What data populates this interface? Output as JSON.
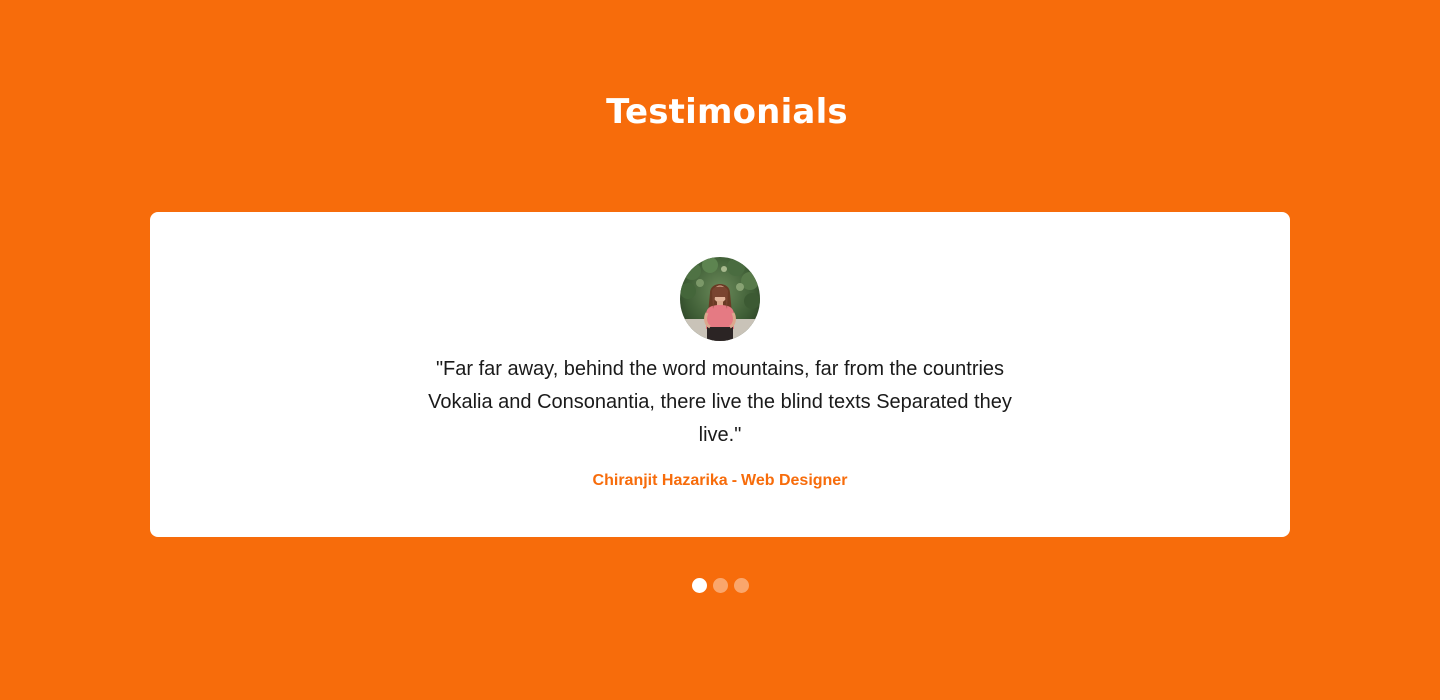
{
  "section": {
    "title": "Testimonials"
  },
  "testimonial": {
    "quote": "\"Far far away, behind the word mountains, far from the countries Vokalia and Consonantia, there live the blind texts Separated they live.\"",
    "author_name": "Chiranjit Hazarika",
    "author_separator": "-",
    "author_role": "Web Designer",
    "avatar_icon": "person-photo-icon"
  },
  "carousel": {
    "slide_count": 3,
    "active_index": 0
  },
  "colors": {
    "background": "#f76c0b",
    "accent": "#f76c0b",
    "card": "#ffffff",
    "text": "#1a1a1a"
  }
}
